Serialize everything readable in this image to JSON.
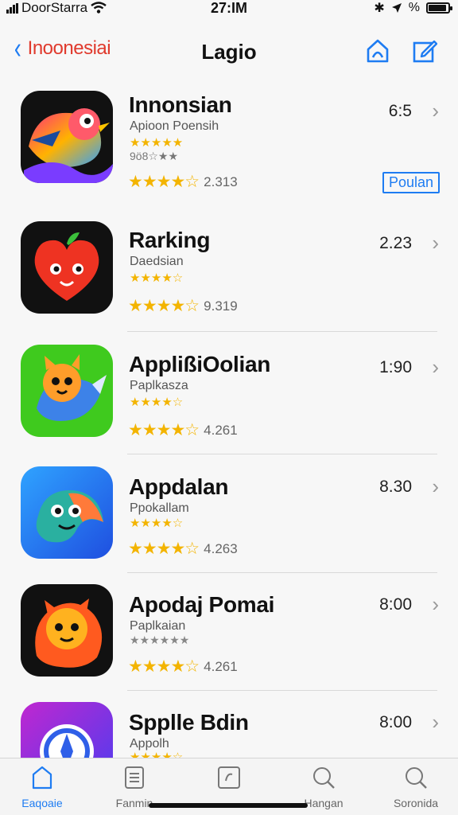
{
  "status_bar": {
    "carrier": "DoorStarra",
    "time": "27:IM",
    "battery_label": "%",
    "battery_level": 0.9
  },
  "nav": {
    "back_label": "Inoonesiai",
    "title": "Lagio"
  },
  "apps": [
    {
      "name": "Innonsian",
      "subtitle": "Apioon Poensih",
      "small_stars": "★★★★★",
      "extra": "9ö8☆★★",
      "stars": "★★★★☆",
      "count": "2.313",
      "time": "6:5",
      "badge": "Poulan",
      "icon": "bird-icon"
    },
    {
      "name": "Rarking",
      "subtitle": "Daedsian",
      "small_stars": "★★★★☆",
      "extra": "",
      "stars": "★★★★☆",
      "count": "9.319",
      "time": "2.23",
      "badge": "",
      "icon": "heart-icon"
    },
    {
      "name": "ApplißiOolian",
      "subtitle": "Paplkasza",
      "small_stars": "★★★★☆",
      "extra": "",
      "stars": "★★★★☆",
      "count": "4.261",
      "time": "1:90",
      "badge": "",
      "icon": "fox-icon"
    },
    {
      "name": "Appdalan",
      "subtitle": "Ppokallam",
      "small_stars": "★★★★☆",
      "extra": "",
      "stars": "★★★★☆",
      "count": "4.263",
      "time": "8.30",
      "badge": "",
      "icon": "fish-icon"
    },
    {
      "name": "Apodaj Pomai",
      "subtitle": "Paplkaian",
      "small_stars": "",
      "extra": "★★★★★★",
      "stars": "★★★★☆",
      "count": "4.261",
      "time": "8:00",
      "badge": "",
      "icon": "cat-icon"
    },
    {
      "name": "Spplle Bdin",
      "subtitle": "Appolh",
      "small_stars": "★★★★☆",
      "extra": "",
      "stars": "",
      "count": "",
      "time": "8:00",
      "badge": "",
      "icon": "compass-icon"
    }
  ],
  "tabbar": {
    "tabs": [
      {
        "label": "Eaqoaie",
        "icon": "home-icon",
        "active": true
      },
      {
        "label": "Fanmin",
        "icon": "document-icon",
        "active": false
      },
      {
        "label": "",
        "icon": "box-icon",
        "active": false
      },
      {
        "label": "Hangan",
        "icon": "search-icon",
        "active": false
      },
      {
        "label": "Soronida",
        "icon": "search-icon",
        "active": false
      }
    ]
  },
  "colors": {
    "accent": "#1e7cf2",
    "back_label": "#e03a2d",
    "star": "#f3b400"
  }
}
